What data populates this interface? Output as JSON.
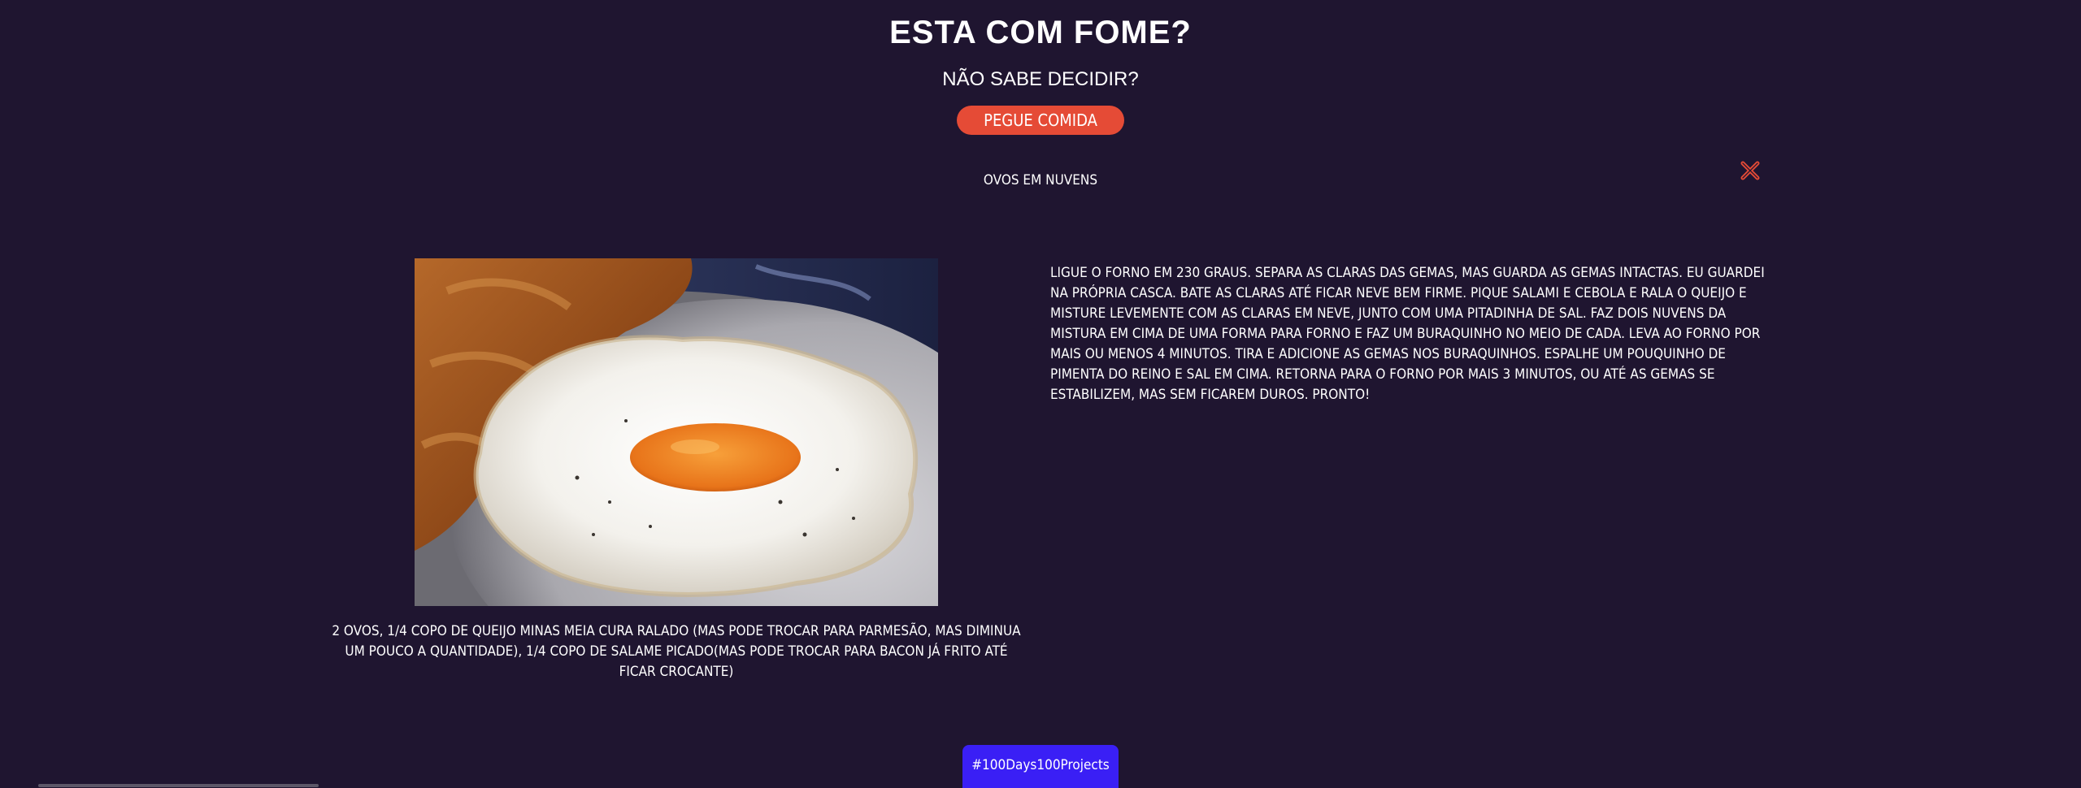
{
  "header": {
    "title": "ESTA COM FOME?",
    "subtitle": "NÃO SABE DECIDIR?",
    "button_label": "PEGUE COMIDA"
  },
  "recipe": {
    "name": "OVOS EM NUVENS",
    "ingredients": "2 OVOS, 1/4 COPO DE QUEIJO MINAS MEIA CURA RALADO (MAS PODE TROCAR PARA PARMESÃO, MAS DIMINUA UM POUCO A QUANTIDADE), 1/4 COPO DE SALAME PICADO(MAS PODE TROCAR PARA BACON JÁ FRITO ATÉ FICAR CROCANTE)",
    "instructions": "LIGUE O FORNO EM 230 GRAUS. SEPARA AS CLARAS DAS GEMAS, MAS GUARDA AS GEMAS INTACTAS. EU GUARDEI NA PRÓPRIA CASCA. BATE AS CLARAS ATÉ FICAR NEVE BEM FIRME. PIQUE SALAMI E CEBOLA E RALA O QUEIJO E MISTURE LEVEMENTE COM AS CLARAS EM NEVE, JUNTO COM UMA PITADINHA DE SAL. FAZ DOIS NUVENS DA MISTURA EM CIMA DE UMA FORMA PARA FORNO E FAZ UM BURAQUINHO NO MEIO DE CADA. LEVA AO FORNO POR MAIS OU MENOS 4 MINUTOS. TIRA E ADICIONE AS GEMAS NOS BURAQUINHOS. ESPALHE UM POUQUINHO DE PIMENTA DO REINO E SAL EM CIMA. RETORNA PARA O FORNO POR MAIS 3 MINUTOS, OU ATÉ AS GEMAS SE ESTABILIZEM, MAS SEM FICAREM DUROS. PRONTO!"
  },
  "footer": {
    "tag": "#100Days100Projects"
  },
  "icons": {
    "close": "close-icon"
  },
  "colors": {
    "background": "#1f1530",
    "button": "#e54b36",
    "badge": "#3a1ff5",
    "close": "#e54b36"
  }
}
